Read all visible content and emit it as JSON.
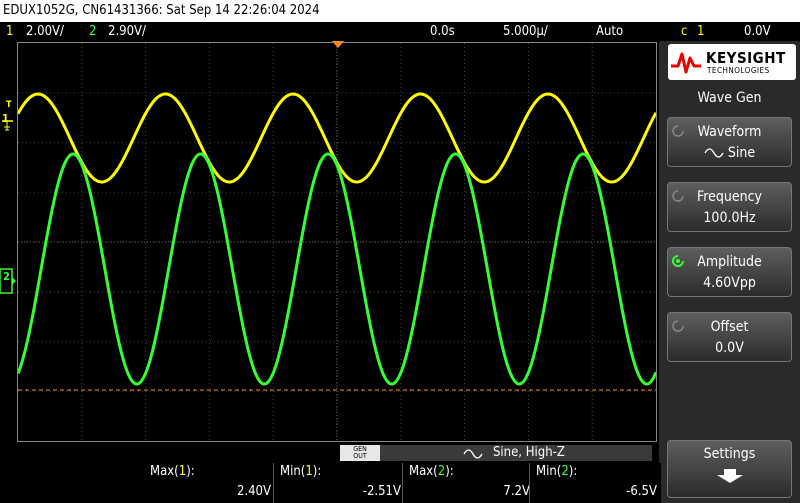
{
  "title_bar": {
    "text": "EDUX1052G, CN61431366: Sat Sep 14 22:26:04 2024"
  },
  "status_bar": {
    "ch1_num": "1",
    "ch1_scale": "2.00V/",
    "ch2_num": "2",
    "ch2_scale": "2.90V/",
    "time_offset": "0.0s",
    "time_scale": "5.000µ/",
    "trigger_mode": "Auto",
    "trigger_slope": "ϲ",
    "trigger_source": "1",
    "trigger_level": "0.0V"
  },
  "colors": {
    "ch1": "#ffff00",
    "ch2": "#33ff33",
    "grid": "#555555",
    "trigger_line": "#ff8c1a",
    "panel": "#2a2a2a"
  },
  "channel_markers": {
    "ch1": "1",
    "ch2": "2",
    "trigger": "T"
  },
  "logo": {
    "brand": "KEYSIGHT",
    "sub": "TECHNOLOGIES"
  },
  "side_menu": {
    "title": "Wave Gen",
    "buttons": [
      {
        "label": "Waveform",
        "value": "Sine",
        "value_icon": "sine-icon",
        "active": false
      },
      {
        "label": "Frequency",
        "value": "100.0Hz",
        "active": false
      },
      {
        "label": "Amplitude",
        "value": "4.60Vpp",
        "active": true
      },
      {
        "label": "Offset",
        "value": "0.0V",
        "active": false
      }
    ],
    "settings": "Settings"
  },
  "gen_bar": {
    "gen_out": "GEN\nOUT",
    "gen_out_top": "GEN",
    "gen_out_bottom": "OUT",
    "mode": "Sine, High-Z"
  },
  "measurements": [
    {
      "label": "Max(1):",
      "value": "2.40V"
    },
    {
      "label": "Min(1):",
      "value": "-2.51V"
    },
    {
      "label": "Max(2):",
      "value": "7.2V"
    },
    {
      "label": "Min(2):",
      "value": "-6.5V"
    }
  ]
}
